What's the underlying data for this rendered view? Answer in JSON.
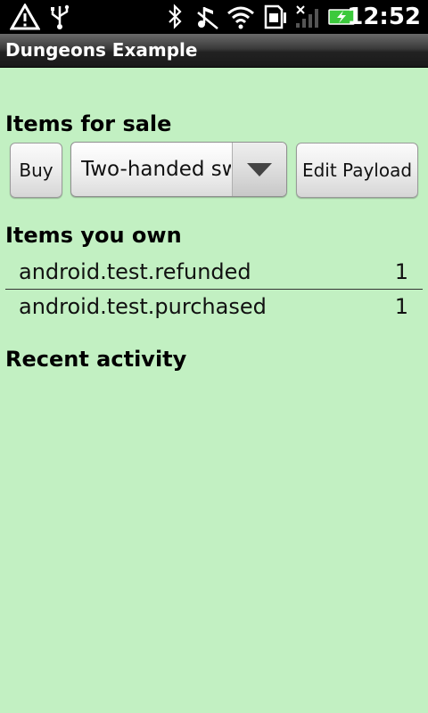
{
  "status_bar": {
    "time": "12:52",
    "icons": [
      "warning-icon",
      "usb-icon",
      "bluetooth-icon",
      "music-muted-icon",
      "wifi-icon",
      "sd-card-icon",
      "signal-icon",
      "battery-charging-icon"
    ]
  },
  "app": {
    "title": "Dungeons Example"
  },
  "sale": {
    "header": "Items for sale",
    "buy_label": "Buy",
    "spinner_value": "Two-handed sw",
    "edit_payload_label": "Edit Payload"
  },
  "owned": {
    "header": "Items you own",
    "items": [
      {
        "name": "android.test.refunded",
        "qty": "1"
      },
      {
        "name": "android.test.purchased",
        "qty": "1"
      }
    ]
  },
  "activity": {
    "header": "Recent activity"
  },
  "colors": {
    "background": "#c2f0c2",
    "status_bar": "#000000",
    "battery_green": "#3cc93c"
  }
}
